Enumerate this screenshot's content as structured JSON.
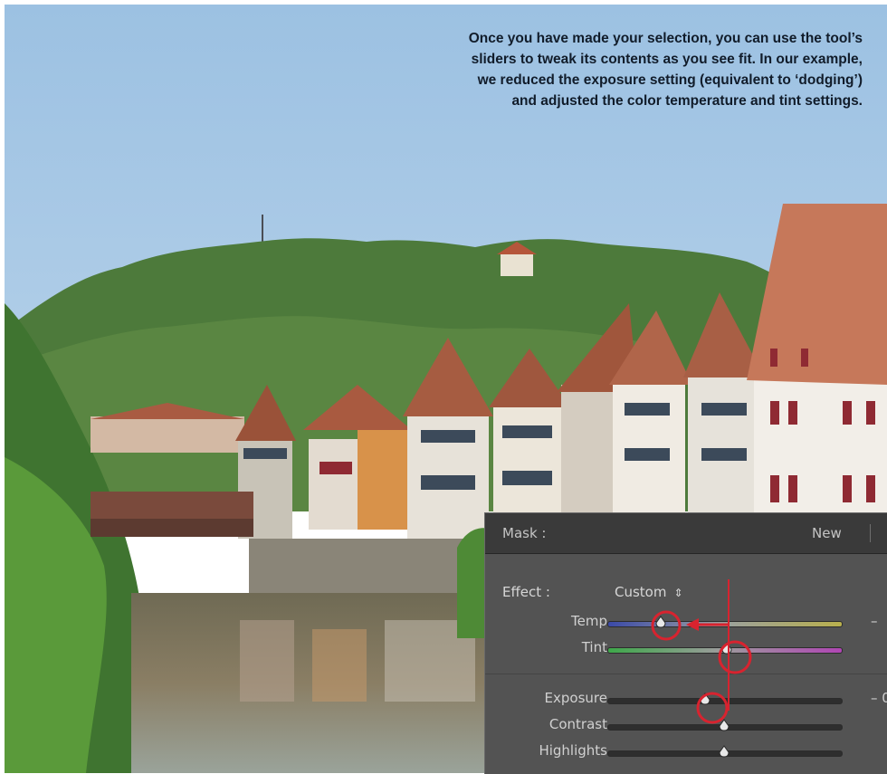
{
  "caption": {
    "lines": [
      "Once you have made your selection, you can use the tool’s",
      "sliders to tweak its contents as you see fit. In our example,",
      "we reduced the exposure setting (equivalent to ‘dodging’)",
      "and adjusted the color temperature and tint settings."
    ]
  },
  "photo": {
    "subject": "half-timbered riverside town with wooded hill and blue sky",
    "colors": {
      "sky": "#a8c8e4",
      "foliage": "#4f7d3c",
      "river": "#6d6a55",
      "roof": "#b5694a"
    }
  },
  "panel": {
    "mask_label": "Mask :",
    "new_label": "New",
    "effect_label": "Effect :",
    "effect_value": "Custom",
    "sliders": [
      {
        "label": "Temp",
        "value": "–",
        "level": 0.23
      },
      {
        "label": "Tint",
        "value": "",
        "level": 0.51
      },
      {
        "label": "Exposure",
        "value": "– 0",
        "level": 0.42
      },
      {
        "label": "Contrast",
        "value": "",
        "level": 0.5
      },
      {
        "label": "Highlights",
        "value": "",
        "level": 0.5
      }
    ]
  },
  "annotation_colors": {
    "marker": "#d8232f"
  }
}
